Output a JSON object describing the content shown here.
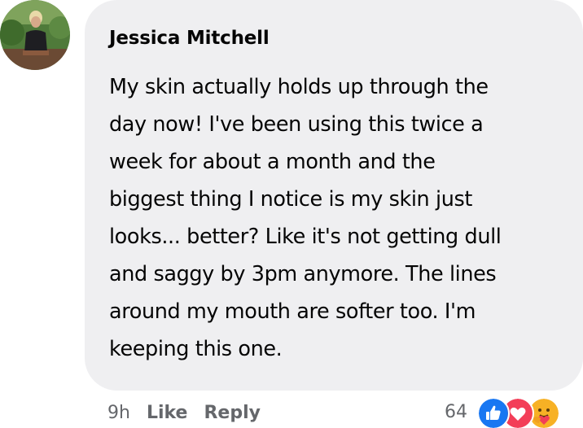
{
  "comment": {
    "author": "Jessica Mitchell",
    "text": "My skin actually holds up through the\nday now! I've been using this twice a\nweek for about a month and the\nbiggest thing I notice is my skin just\nlooks... better? Like it's not getting dull\nand saggy by 3pm anymore. The lines\naround my mouth are softer too. I'm\nkeeping this one.",
    "timestamp": "9h",
    "like_label": "Like",
    "reply_label": "Reply",
    "reaction_count": "64",
    "reactions": [
      "like-icon",
      "love-icon",
      "care-icon"
    ]
  },
  "colors": {
    "bubble_bg": "#efeff1",
    "text": "#050505",
    "meta_text": "#65676b",
    "like_blue": "#1877f2",
    "love_red": "#f33e58",
    "care_yellow": "#f7b125"
  }
}
